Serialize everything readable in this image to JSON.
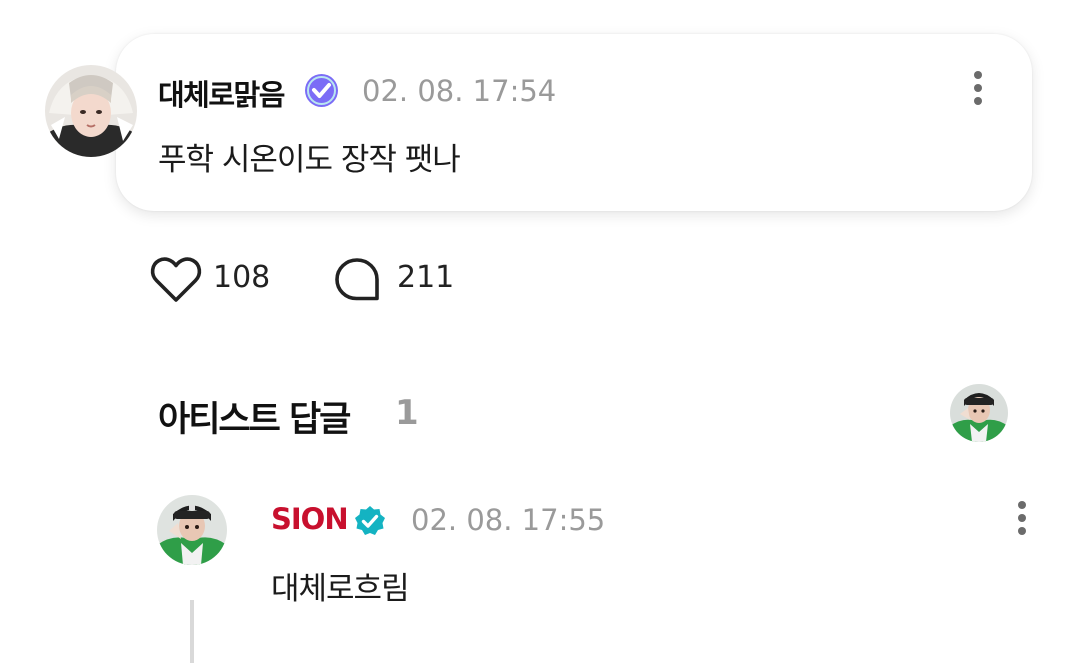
{
  "post": {
    "author": "대체로맑음",
    "author_badge_icon": "verified-membership-badge-icon",
    "timestamp": "02. 08. 17:54",
    "body": "푸학 시온이도 장작 팻나",
    "more_icon": "more-vertical-icon"
  },
  "reactions": {
    "like_icon": "heart-icon",
    "like_count": "108",
    "comment_icon": "speech-bubble-icon",
    "comment_count": "211"
  },
  "artist_replies": {
    "title": "아티스트 답글",
    "count": "1"
  },
  "reply": {
    "author": "SION",
    "author_color": "#c8102e",
    "author_badge_icon": "artist-verified-badge-icon",
    "timestamp": "02. 08. 17:55",
    "body": "대체로흐림",
    "more_icon": "more-vertical-icon"
  },
  "colors": {
    "badge_purple": "#7b6cf6",
    "badge_teal": "#14b3c2",
    "muted_text": "#9a9a9a"
  }
}
